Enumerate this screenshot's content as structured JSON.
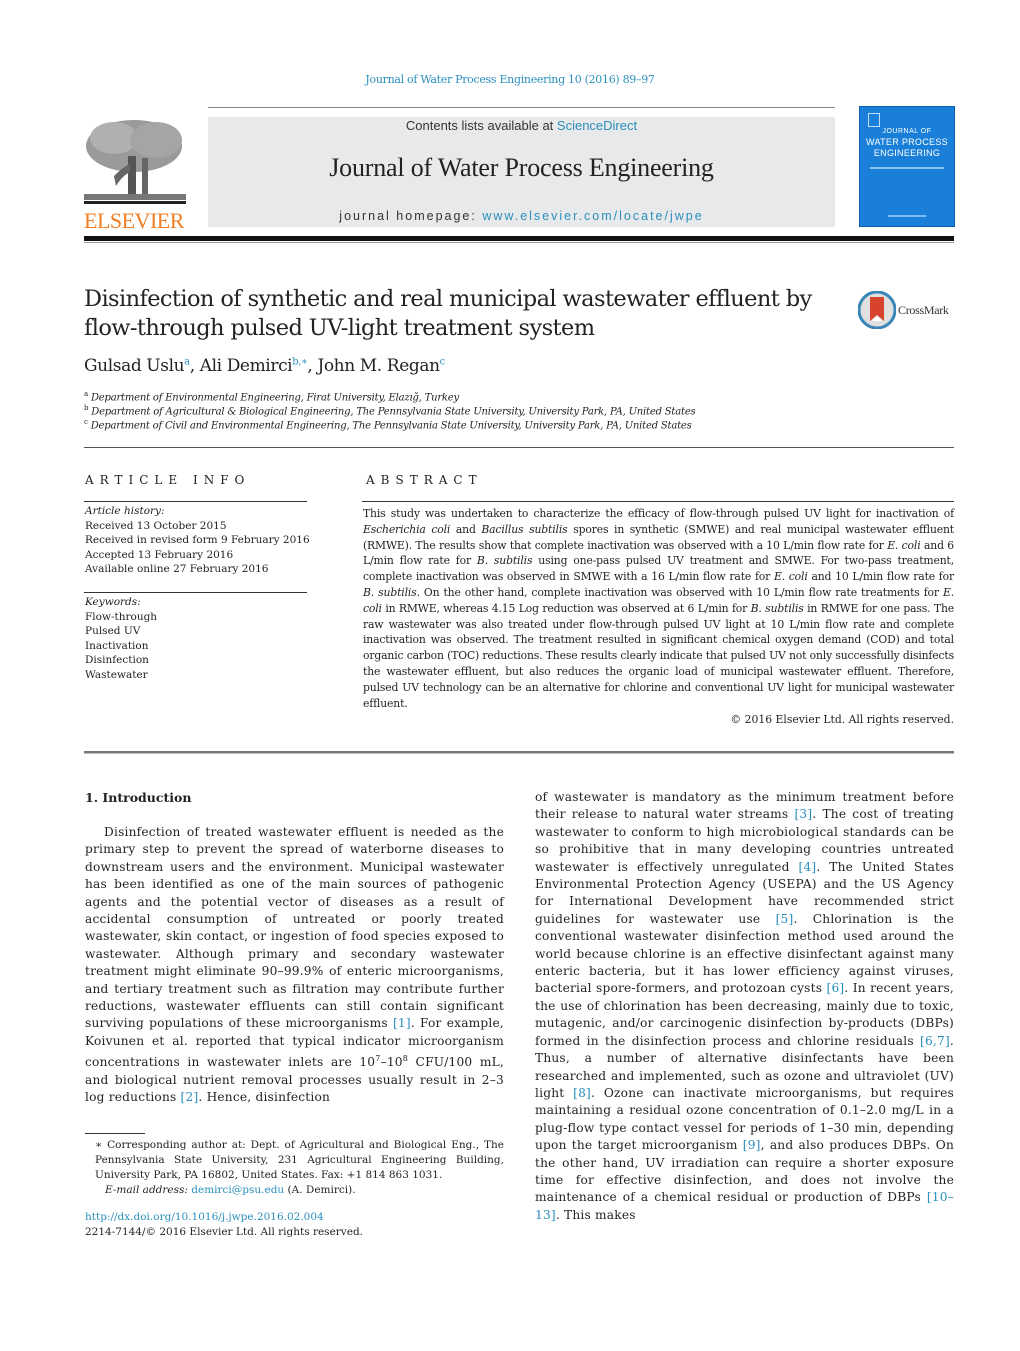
{
  "citation": "Journal of Water Process Engineering 10 (2016) 89–97",
  "header": {
    "publisher_name": "ELSEVIER",
    "contents_prefix": "Contents lists available at ",
    "contents_link": "ScienceDirect",
    "journal_title": "Journal of Water Process Engineering",
    "homepage_prefix": "journal homepage: ",
    "homepage_link": "www.elsevier.com/locate/jwpe",
    "cover": {
      "line1": "JOURNAL OF",
      "line2": "WATER PROCESS",
      "line3": "ENGINEERING"
    },
    "colors": {
      "link": "#2a8fbd",
      "elsevier_orange": "#f07d21",
      "cover_blue": "#1a7fd8"
    }
  },
  "article": {
    "title": "Disinfection of synthetic and real municipal wastewater effluent by flow-through pulsed UV-light treatment system",
    "crossmark_label": "CrossMark",
    "authors": [
      {
        "name": "Gulsad Uslu",
        "sup": "a"
      },
      {
        "name": "Ali Demirci",
        "sup": "b,∗"
      },
      {
        "name": "John M. Regan",
        "sup": "c"
      }
    ],
    "affiliations": [
      {
        "key": "a",
        "text": "Department of Environmental Engineering, Firat University, Elazığ, Turkey"
      },
      {
        "key": "b",
        "text": "Department of Agricultural & Biological Engineering, The Pennsylvania State University, University Park, PA, United States"
      },
      {
        "key": "c",
        "text": "Department of Civil and Environmental Engineering, The Pennsylvania State University, University Park, PA, United States"
      }
    ]
  },
  "article_info": {
    "heading": "ARTICLE INFO",
    "history_label": "Article history:",
    "history": [
      "Received 13 October 2015",
      "Received in revised form 9 February 2016",
      "Accepted 13 February 2016",
      "Available online 27 February 2016"
    ],
    "keywords_label": "Keywords:",
    "keywords": [
      "Flow-through",
      "Pulsed UV",
      "Inactivation",
      "Disinfection",
      "Wastewater"
    ]
  },
  "abstract": {
    "heading": "ABSTRACT",
    "segments": [
      {
        "t": "This study was undertaken to characterize the efficacy of flow-through pulsed UV light for inactivation of "
      },
      {
        "t": "Escherichia coli",
        "i": true
      },
      {
        "t": " and "
      },
      {
        "t": "Bacillus subtilis",
        "i": true
      },
      {
        "t": " spores in synthetic (SMWE) and real municipal wastewater effluent (RMWE). The results show that complete inactivation was observed with a 10 L/min flow rate for "
      },
      {
        "t": "E. coli",
        "i": true
      },
      {
        "t": " and 6 L/min flow rate for "
      },
      {
        "t": "B. subtilis",
        "i": true
      },
      {
        "t": " using one-pass pulsed UV treatment and SMWE. For two-pass treatment, complete inactivation was observed in SMWE with a 16 L/min flow rate for "
      },
      {
        "t": "E. coli",
        "i": true
      },
      {
        "t": " and 10 L/min flow rate for "
      },
      {
        "t": "B. subtilis",
        "i": true
      },
      {
        "t": ". On the other hand, complete inactivation was observed with 10 L/min flow rate treatments for "
      },
      {
        "t": "E. coli",
        "i": true
      },
      {
        "t": " in RMWE, whereas 4.15 Log reduction was observed at 6 L/min for "
      },
      {
        "t": "B. subtilis",
        "i": true
      },
      {
        "t": " in RMWE for one pass. The raw wastewater was also treated under flow-through pulsed UV light at 10 L/min flow rate and complete inactivation was observed. The treatment resulted in significant chemical oxygen demand (COD) and total organic carbon (TOC) reductions. These results clearly indicate that pulsed UV not only successfully disinfects the wastewater effluent, but also reduces the organic load of municipal wastewater effluent. Therefore, pulsed UV technology can be an alternative for chlorine and conventional UV light for municipal wastewater effluent."
      }
    ],
    "copyright": "© 2016 Elsevier Ltd. All rights reserved."
  },
  "introduction": {
    "heading": "1.  Introduction",
    "left_segments": [
      {
        "t": "Disinfection of treated wastewater effluent is needed as the primary step to prevent the spread of waterborne diseases to downstream users and the environment. Municipal wastewater has been identified as one of the main sources of pathogenic agents and the potential vector of diseases as a result of accidental consumption of untreated or poorly treated wastewater, skin contact, or ingestion of food species exposed to wastewater. Although primary and secondary wastewater treatment might eliminate 90–99.9% of enteric microorganisms, and tertiary treatment such as filtration may contribute further reductions, wastewater effluents can still contain significant surviving populations of these microorganisms "
      },
      {
        "t": "[1]",
        "ref": true
      },
      {
        "t": ". For example, Koivunen et al. reported that typical indicator microorganism concentrations in wastewater inlets are 10"
      },
      {
        "t": "7",
        "sup": true
      },
      {
        "t": "–10"
      },
      {
        "t": "8",
        "sup": true
      },
      {
        "t": " CFU/100 mL, and biological nutrient removal processes usually result in 2–3 log reductions "
      },
      {
        "t": "[2]",
        "ref": true
      },
      {
        "t": ". Hence, disinfection"
      }
    ],
    "right_segments": [
      {
        "t": "of wastewater is mandatory as the minimum treatment before their release to natural water streams "
      },
      {
        "t": "[3]",
        "ref": true
      },
      {
        "t": ". The cost of treating wastewater to conform to high microbiological standards can be so prohibitive that in many developing countries untreated wastewater is effectively unregulated "
      },
      {
        "t": "[4]",
        "ref": true
      },
      {
        "t": ". The United States Environmental Protection Agency (USEPA) and the US Agency for International Development have recommended strict guidelines for wastewater use "
      },
      {
        "t": "[5]",
        "ref": true
      },
      {
        "t": ". Chlorination is the conventional wastewater disinfection method used around the world because chlorine is an effective disinfectant against many enteric bacteria, but it has lower efficiency against viruses, bacterial spore-formers, and protozoan cysts "
      },
      {
        "t": "[6]",
        "ref": true
      },
      {
        "t": ". In recent years, the use of chlorination has been decreasing, mainly due to toxic, mutagenic, and/or carcinogenic disinfection by-products (DBPs) formed in the disinfection process and chlorine residuals "
      },
      {
        "t": "[6,7]",
        "ref": true
      },
      {
        "t": ". Thus, a number of alternative disinfectants have been researched and implemented, such as ozone and ultraviolet (UV) light "
      },
      {
        "t": "[8]",
        "ref": true
      },
      {
        "t": ". Ozone can inactivate microorganisms, but requires maintaining a residual ozone concentration of 0.1–2.0 mg/L in a plug-flow type contact vessel for periods of 1–30 min, depending upon the target microorganism "
      },
      {
        "t": "[9]",
        "ref": true
      },
      {
        "t": ", and also produces DBPs. On the other hand, UV irradiation can require a shorter exposure time for effective disinfection, and does not involve the maintenance of a chemical residual or production of DBPs "
      },
      {
        "t": "[10–13]",
        "ref": true
      },
      {
        "t": ". This makes"
      }
    ]
  },
  "footnote": {
    "corresponding": "∗ Corresponding author at: Dept. of Agricultural and Biological Eng., The Pennsylvania State University, 231 Agricultural Engineering Building, University Park, PA 16802, United States. Fax: +1 814 863 1031.",
    "email_label": "E-mail address: ",
    "email": "demirci@psu.edu",
    "email_suffix": " (A. Demirci).",
    "doi": "http://dx.doi.org/10.1016/j.jwpe.2016.02.004",
    "issn": "2214-7144/© 2016 Elsevier Ltd. All rights reserved."
  }
}
